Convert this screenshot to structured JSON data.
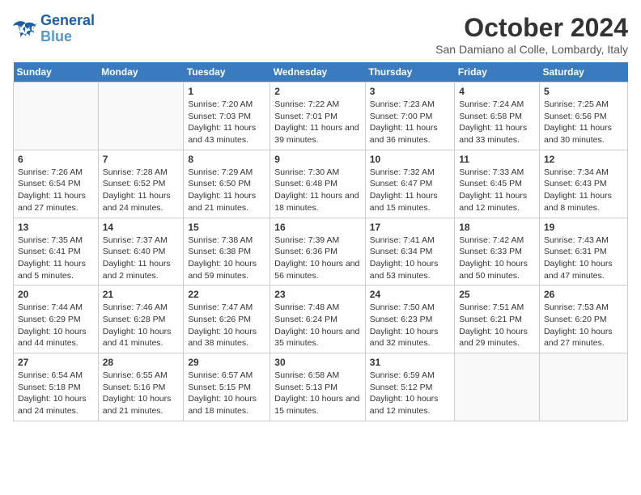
{
  "logo": {
    "line1": "General",
    "line2": "Blue"
  },
  "title": "October 2024",
  "location": "San Damiano al Colle, Lombardy, Italy",
  "weekdays": [
    "Sunday",
    "Monday",
    "Tuesday",
    "Wednesday",
    "Thursday",
    "Friday",
    "Saturday"
  ],
  "weeks": [
    [
      {
        "day": "",
        "info": ""
      },
      {
        "day": "",
        "info": ""
      },
      {
        "day": "1",
        "info": "Sunrise: 7:20 AM\nSunset: 7:03 PM\nDaylight: 11 hours and 43 minutes."
      },
      {
        "day": "2",
        "info": "Sunrise: 7:22 AM\nSunset: 7:01 PM\nDaylight: 11 hours and 39 minutes."
      },
      {
        "day": "3",
        "info": "Sunrise: 7:23 AM\nSunset: 7:00 PM\nDaylight: 11 hours and 36 minutes."
      },
      {
        "day": "4",
        "info": "Sunrise: 7:24 AM\nSunset: 6:58 PM\nDaylight: 11 hours and 33 minutes."
      },
      {
        "day": "5",
        "info": "Sunrise: 7:25 AM\nSunset: 6:56 PM\nDaylight: 11 hours and 30 minutes."
      }
    ],
    [
      {
        "day": "6",
        "info": "Sunrise: 7:26 AM\nSunset: 6:54 PM\nDaylight: 11 hours and 27 minutes."
      },
      {
        "day": "7",
        "info": "Sunrise: 7:28 AM\nSunset: 6:52 PM\nDaylight: 11 hours and 24 minutes."
      },
      {
        "day": "8",
        "info": "Sunrise: 7:29 AM\nSunset: 6:50 PM\nDaylight: 11 hours and 21 minutes."
      },
      {
        "day": "9",
        "info": "Sunrise: 7:30 AM\nSunset: 6:48 PM\nDaylight: 11 hours and 18 minutes."
      },
      {
        "day": "10",
        "info": "Sunrise: 7:32 AM\nSunset: 6:47 PM\nDaylight: 11 hours and 15 minutes."
      },
      {
        "day": "11",
        "info": "Sunrise: 7:33 AM\nSunset: 6:45 PM\nDaylight: 11 hours and 12 minutes."
      },
      {
        "day": "12",
        "info": "Sunrise: 7:34 AM\nSunset: 6:43 PM\nDaylight: 11 hours and 8 minutes."
      }
    ],
    [
      {
        "day": "13",
        "info": "Sunrise: 7:35 AM\nSunset: 6:41 PM\nDaylight: 11 hours and 5 minutes."
      },
      {
        "day": "14",
        "info": "Sunrise: 7:37 AM\nSunset: 6:40 PM\nDaylight: 11 hours and 2 minutes."
      },
      {
        "day": "15",
        "info": "Sunrise: 7:38 AM\nSunset: 6:38 PM\nDaylight: 10 hours and 59 minutes."
      },
      {
        "day": "16",
        "info": "Sunrise: 7:39 AM\nSunset: 6:36 PM\nDaylight: 10 hours and 56 minutes."
      },
      {
        "day": "17",
        "info": "Sunrise: 7:41 AM\nSunset: 6:34 PM\nDaylight: 10 hours and 53 minutes."
      },
      {
        "day": "18",
        "info": "Sunrise: 7:42 AM\nSunset: 6:33 PM\nDaylight: 10 hours and 50 minutes."
      },
      {
        "day": "19",
        "info": "Sunrise: 7:43 AM\nSunset: 6:31 PM\nDaylight: 10 hours and 47 minutes."
      }
    ],
    [
      {
        "day": "20",
        "info": "Sunrise: 7:44 AM\nSunset: 6:29 PM\nDaylight: 10 hours and 44 minutes."
      },
      {
        "day": "21",
        "info": "Sunrise: 7:46 AM\nSunset: 6:28 PM\nDaylight: 10 hours and 41 minutes."
      },
      {
        "day": "22",
        "info": "Sunrise: 7:47 AM\nSunset: 6:26 PM\nDaylight: 10 hours and 38 minutes."
      },
      {
        "day": "23",
        "info": "Sunrise: 7:48 AM\nSunset: 6:24 PM\nDaylight: 10 hours and 35 minutes."
      },
      {
        "day": "24",
        "info": "Sunrise: 7:50 AM\nSunset: 6:23 PM\nDaylight: 10 hours and 32 minutes."
      },
      {
        "day": "25",
        "info": "Sunrise: 7:51 AM\nSunset: 6:21 PM\nDaylight: 10 hours and 29 minutes."
      },
      {
        "day": "26",
        "info": "Sunrise: 7:53 AM\nSunset: 6:20 PM\nDaylight: 10 hours and 27 minutes."
      }
    ],
    [
      {
        "day": "27",
        "info": "Sunrise: 6:54 AM\nSunset: 5:18 PM\nDaylight: 10 hours and 24 minutes."
      },
      {
        "day": "28",
        "info": "Sunrise: 6:55 AM\nSunset: 5:16 PM\nDaylight: 10 hours and 21 minutes."
      },
      {
        "day": "29",
        "info": "Sunrise: 6:57 AM\nSunset: 5:15 PM\nDaylight: 10 hours and 18 minutes."
      },
      {
        "day": "30",
        "info": "Sunrise: 6:58 AM\nSunset: 5:13 PM\nDaylight: 10 hours and 15 minutes."
      },
      {
        "day": "31",
        "info": "Sunrise: 6:59 AM\nSunset: 5:12 PM\nDaylight: 10 hours and 12 minutes."
      },
      {
        "day": "",
        "info": ""
      },
      {
        "day": "",
        "info": ""
      }
    ]
  ]
}
